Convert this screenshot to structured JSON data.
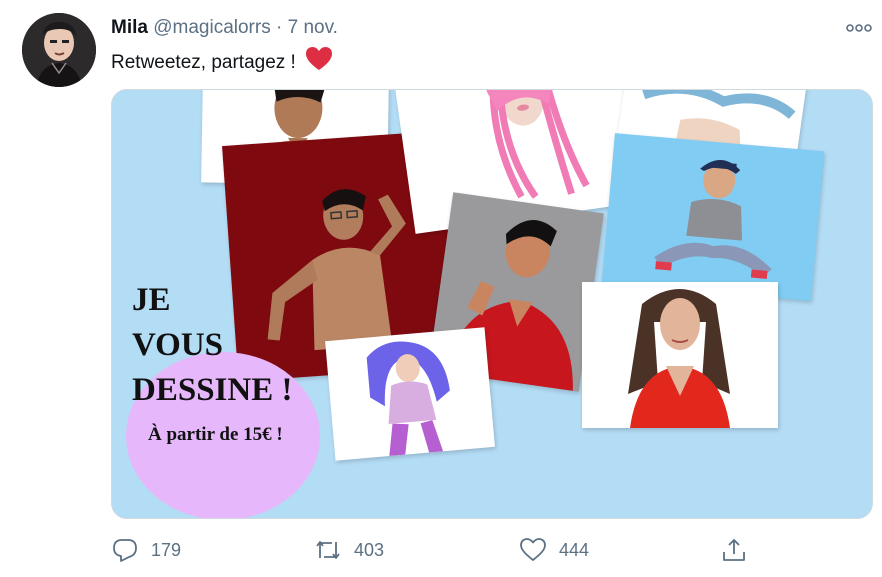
{
  "tweet": {
    "author_name": "Mila",
    "author_handle": "@magicalorrs",
    "separator": "·",
    "date": "7 nov.",
    "text": "Retweetez, partagez !",
    "emoji_icon": "red-heart-icon"
  },
  "media": {
    "background_color": "#b3dcf5",
    "flyer_lines": [
      "JE",
      "VOUS",
      "DESSINE !"
    ],
    "price_text": "À partir de 15€ !",
    "blob_color": "#e6b8fb"
  },
  "actions": {
    "reply_count": "179",
    "retweet_count": "403",
    "like_count": "444",
    "icons": [
      "reply-icon",
      "retweet-icon",
      "like-icon",
      "share-icon"
    ]
  },
  "colors": {
    "accent_red": "#e0245e",
    "muted": "#5b7083"
  }
}
